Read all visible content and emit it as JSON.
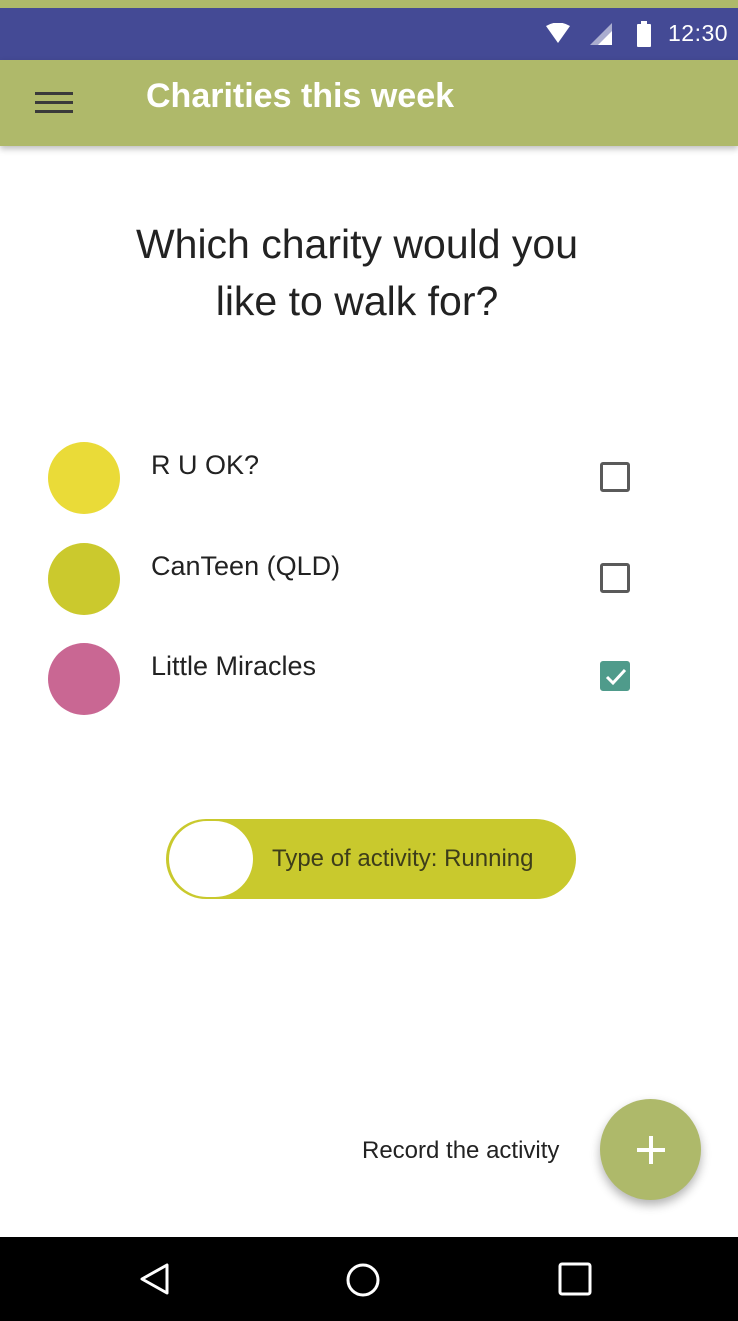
{
  "status_bar": {
    "time": "12:30",
    "icons": [
      "wifi-icon",
      "cell-signal-icon",
      "battery-icon"
    ]
  },
  "app_bar": {
    "title": "Charities this week",
    "menu_icon": "hamburger-menu-icon"
  },
  "question": {
    "line1": "Which charity would you",
    "line2": "like to walk for?"
  },
  "charities": [
    {
      "name": "R U OK?",
      "color": "#eadb38",
      "checked": false
    },
    {
      "name": "CanTeen (QLD)",
      "color": "#cbc92d",
      "checked": false
    },
    {
      "name": "Little Miracles",
      "color": "#c96793",
      "checked": true
    }
  ],
  "activity_toggle": {
    "label": "Type of activity: Running",
    "color": "#c9c92d"
  },
  "record": {
    "label": "Record the activity",
    "fab_icon": "plus-icon",
    "fab_color": "#aeb96a"
  },
  "nav_bar": {
    "icons": [
      "back-triangle-icon",
      "home-circle-icon",
      "recents-square-icon"
    ]
  },
  "colors": {
    "status_bar": "#444a95",
    "app_bar": "#afb96a",
    "checkbox_checked": "#4f9b8b"
  }
}
